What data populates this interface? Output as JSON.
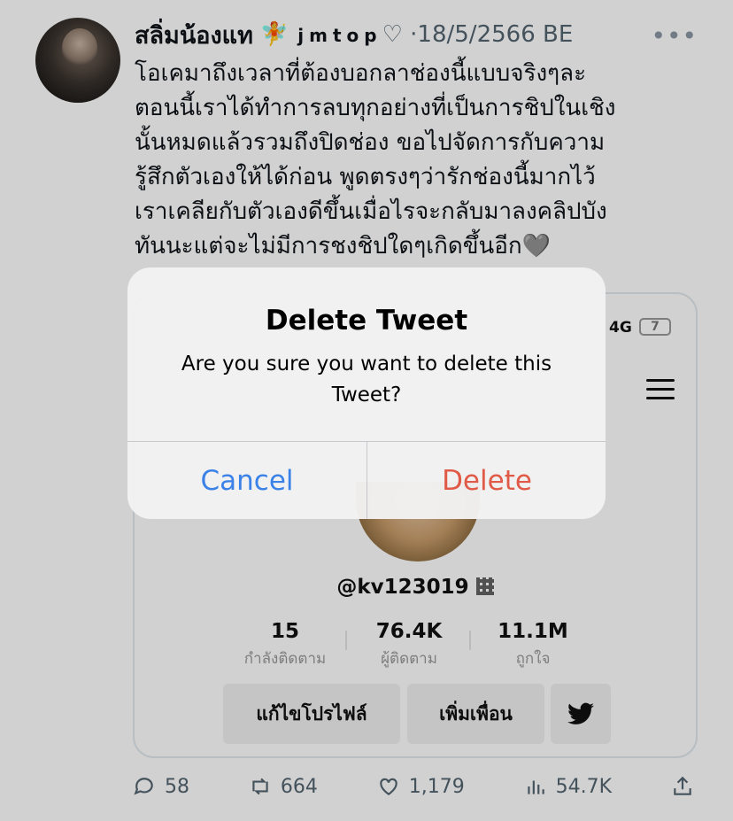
{
  "tweet": {
    "display_name": "สลิ่มน้องแท",
    "name_emoji": "🧚",
    "handle_brand": "jmtop",
    "handle_suffix": "♡",
    "separator": "·",
    "date": "18/5/2566 BE",
    "more": "•••",
    "text_lines": [
      "โอเคมาถึงเวลาที่ต้องบอกลาช่องนี้แบบจริงๆละ",
      "ตอนนี้เราได้ทำการลบทุกอย่างที่เป็นการชิปในเชิง",
      "นั้นหมดแล้วรวมถึงปิดช่อง ขอไปจัดการกับความ",
      "รู้สึกตัวเองให้ได้ก่อน พูดตรงๆว่ารักช่องนี้มากไว้",
      "เราเคลียกับตัวเองดีขึ้นเมื่อไรจะกลับมาลงคลิปบัง",
      "ทันนะแต่จะไม่มีการชงชิปใดๆเกิดขึ้นอีก🩶"
    ]
  },
  "media": {
    "network": "4G",
    "battery": "7",
    "username": "@kv123019",
    "stats": [
      {
        "value": "15",
        "label": "กำลังติดตาม"
      },
      {
        "value": "76.4K",
        "label": "ผู้ติดตาม"
      },
      {
        "value": "11.1M",
        "label": "ถูกใจ"
      }
    ],
    "edit_profile_label": "แก้ไขโปรไฟล์",
    "add_friend_label": "เพิ่มเพื่อน"
  },
  "footer": {
    "replies": "58",
    "retweets": "664",
    "likes": "1,179",
    "views": "54.7K"
  },
  "alert": {
    "title": "Delete Tweet",
    "message": "Are you sure you want to delete this Tweet?",
    "cancel_label": "Cancel",
    "delete_label": "Delete",
    "cancel_color": "#3b82e8",
    "delete_color": "#e05a47"
  }
}
